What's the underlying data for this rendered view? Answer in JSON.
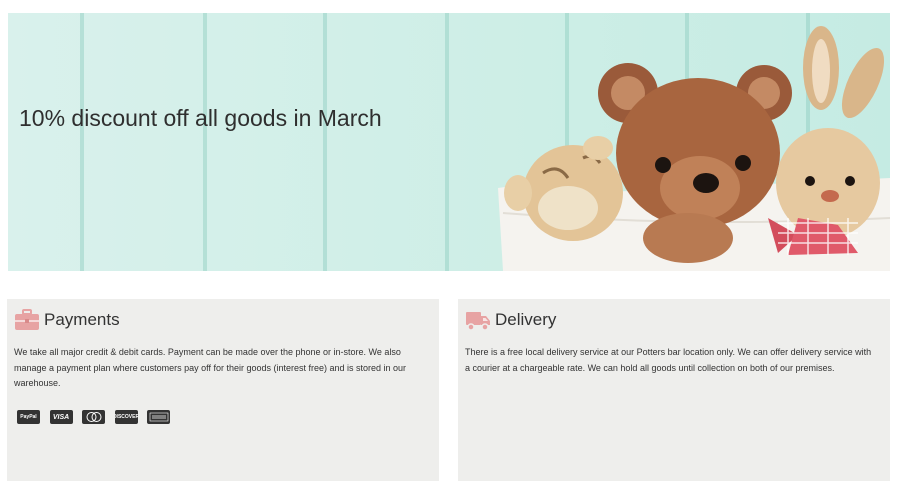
{
  "banner": {
    "headline": "10% discount off all goods in March",
    "image_alt": "teddy-bears-in-basket"
  },
  "payments": {
    "title": "Payments",
    "icon": "briefcase-icon",
    "text": "We take all major credit & debit cards. Payment can be made over the phone or in-store. We also manage a payment plan where customers pay off for their goods (interest free) and is stored in our warehouse.",
    "cards": [
      "PayPal",
      "VISA",
      "MasterCard",
      "DISCOVER",
      "AMERICAN EXPRESS"
    ]
  },
  "delivery": {
    "title": "Delivery",
    "icon": "truck-icon",
    "text": "There is a free local delivery service at our Potters bar location only. We can offer delivery service with a courier at a chargeable rate. We can hold all goods until collection on both of our premises."
  },
  "colors": {
    "banner_bg": "#cdeee6",
    "panel_bg": "#eeeeec",
    "icon_pink": "#e7a3a3",
    "card_dark": "#333333"
  }
}
